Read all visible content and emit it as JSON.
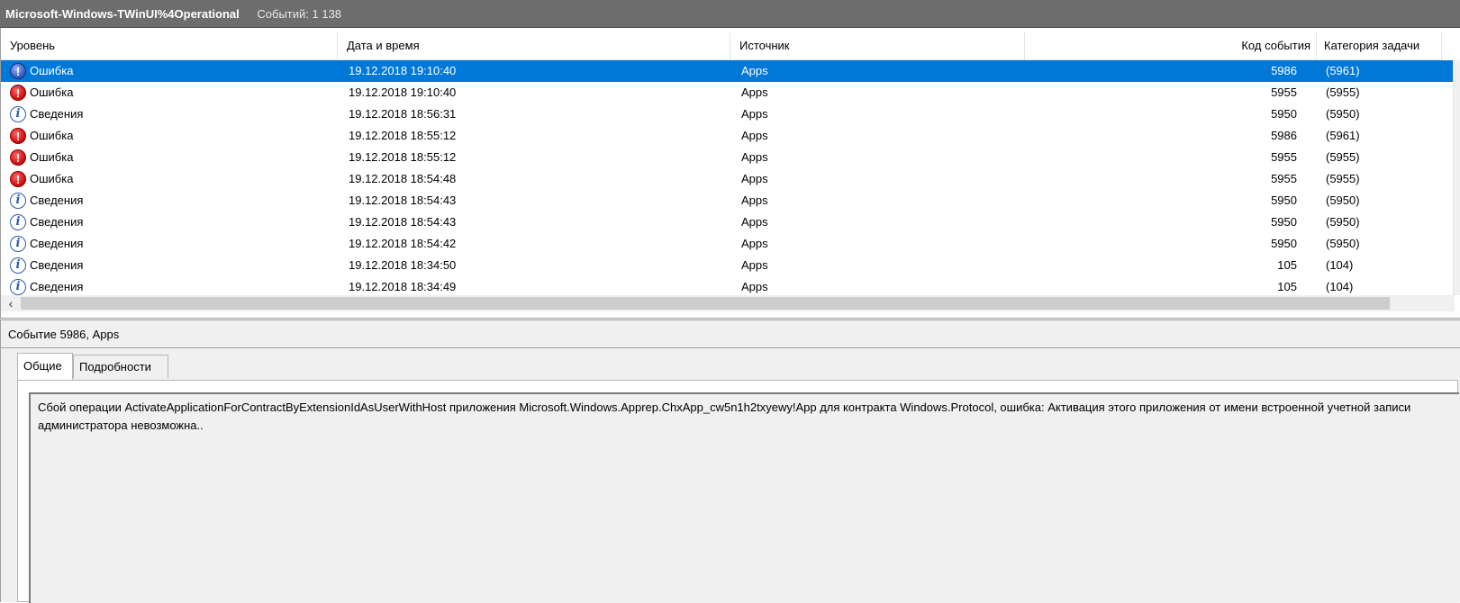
{
  "titlebar": {
    "log_name": "Microsoft-Windows-TWinUI%4Operational",
    "event_count": "Событий: 1 138"
  },
  "columns": {
    "level": "Уровень",
    "date": "Дата и время",
    "source": "Источник",
    "event_id": "Код события",
    "task_category": "Категория задачи"
  },
  "rows": [
    {
      "type": "error",
      "level": "Ошибка",
      "date": "19.12.2018 19:10:40",
      "source": "Apps",
      "event_id": "5986",
      "category": "(5961)",
      "selected": true
    },
    {
      "type": "error",
      "level": "Ошибка",
      "date": "19.12.2018 19:10:40",
      "source": "Apps",
      "event_id": "5955",
      "category": "(5955)"
    },
    {
      "type": "info",
      "level": "Сведения",
      "date": "19.12.2018 18:56:31",
      "source": "Apps",
      "event_id": "5950",
      "category": "(5950)"
    },
    {
      "type": "error",
      "level": "Ошибка",
      "date": "19.12.2018 18:55:12",
      "source": "Apps",
      "event_id": "5986",
      "category": "(5961)"
    },
    {
      "type": "error",
      "level": "Ошибка",
      "date": "19.12.2018 18:55:12",
      "source": "Apps",
      "event_id": "5955",
      "category": "(5955)"
    },
    {
      "type": "error",
      "level": "Ошибка",
      "date": "19.12.2018 18:54:48",
      "source": "Apps",
      "event_id": "5955",
      "category": "(5955)"
    },
    {
      "type": "info",
      "level": "Сведения",
      "date": "19.12.2018 18:54:43",
      "source": "Apps",
      "event_id": "5950",
      "category": "(5950)"
    },
    {
      "type": "info",
      "level": "Сведения",
      "date": "19.12.2018 18:54:43",
      "source": "Apps",
      "event_id": "5950",
      "category": "(5950)"
    },
    {
      "type": "info",
      "level": "Сведения",
      "date": "19.12.2018 18:54:42",
      "source": "Apps",
      "event_id": "5950",
      "category": "(5950)"
    },
    {
      "type": "info",
      "level": "Сведения",
      "date": "19.12.2018 18:34:50",
      "source": "Apps",
      "event_id": "105",
      "category": "(104)"
    },
    {
      "type": "info",
      "level": "Сведения",
      "date": "19.12.2018 18:34:49",
      "source": "Apps",
      "event_id": "105",
      "category": "(104)"
    }
  ],
  "icons": {
    "error": "error-icon",
    "info": "info-icon",
    "scroll_left": "scroll-left-arrow-icon"
  },
  "colors": {
    "selection": "#0078d7",
    "titlebar": "#6d6d6d"
  },
  "detail": {
    "title": "Событие 5986, Apps",
    "tabs": [
      "Общие",
      "Подробности"
    ],
    "message": "Сбой операции ActivateApplicationForContractByExtensionIdAsUserWithHost приложения Microsoft.Windows.Apprep.ChxApp_cw5n1h2txyewy!App для контракта Windows.Protocol, ошибка: Активация этого приложения от имени встроенной учетной записи администратора невозможна.."
  }
}
